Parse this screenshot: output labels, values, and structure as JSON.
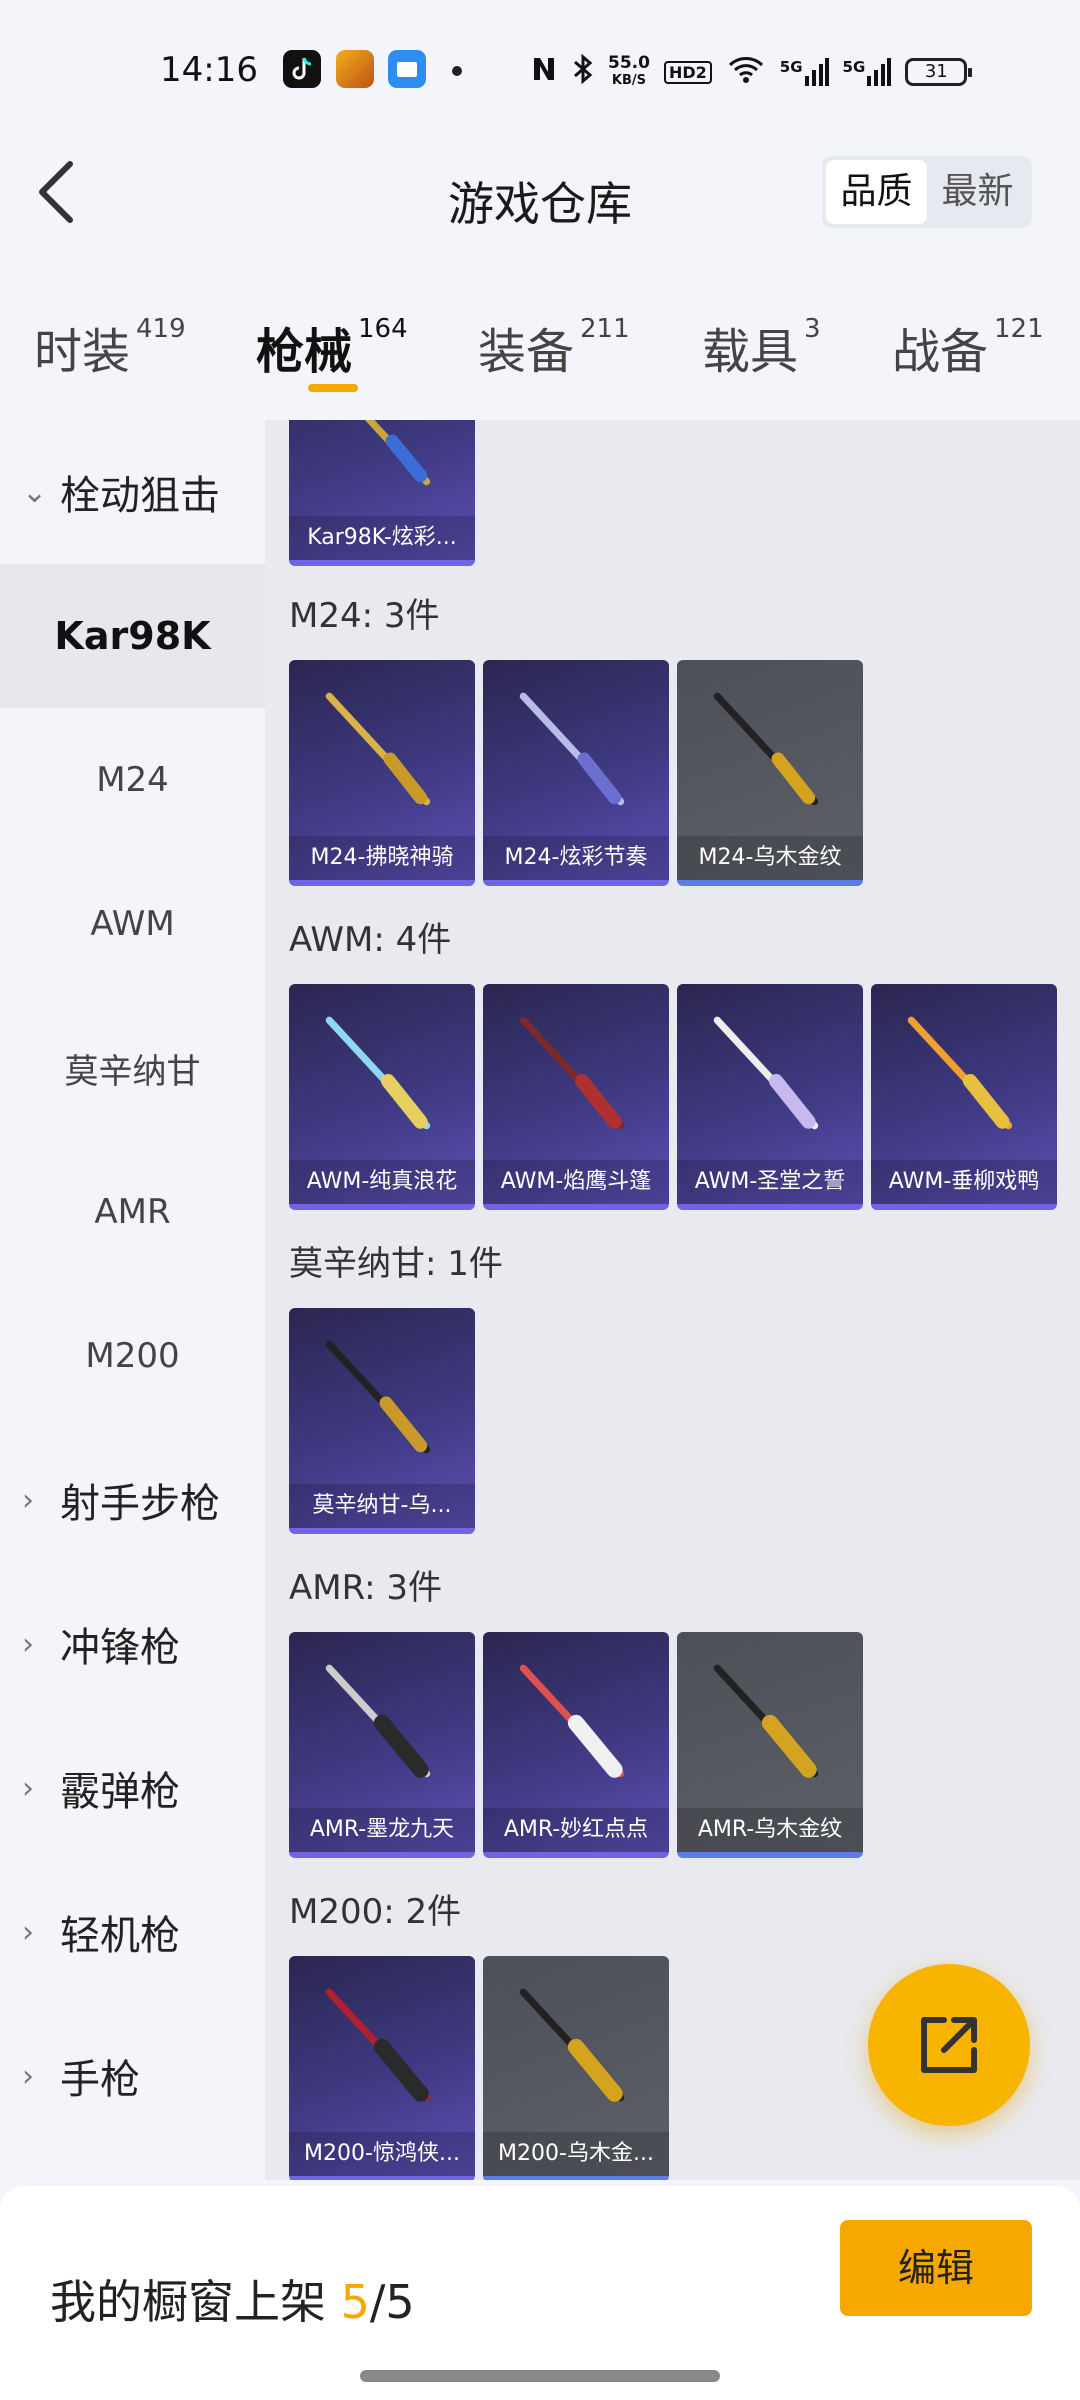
{
  "status_bar": {
    "time": "14:16",
    "net_speed": "55.0",
    "net_unit": "KB/S",
    "hd": "HD2",
    "sig1": "5G",
    "sig2": "5G",
    "battery": "31",
    "icons": [
      "tiktok-icon",
      "game-app-icon",
      "files-app-icon",
      "nfc-icon",
      "bluetooth-icon",
      "wifi-icon"
    ]
  },
  "header": {
    "title": "游戏仓库",
    "sort_options": [
      "品质",
      "最新"
    ],
    "sort_active": "品质"
  },
  "tabs": [
    {
      "label": "时装",
      "count": "419"
    },
    {
      "label": "枪械",
      "count": "164"
    },
    {
      "label": "装备",
      "count": "211"
    },
    {
      "label": "载具",
      "count": "3"
    },
    {
      "label": "战备",
      "count": "121"
    }
  ],
  "active_tab": "枪械",
  "sidebar": {
    "expanded_group": "栓动狙击",
    "sub_items": [
      "Kar98K",
      "M24",
      "AWM",
      "莫辛纳甘",
      "AMR",
      "M200"
    ],
    "selected_sub": "Kar98K",
    "groups": [
      "射手步枪",
      "冲锋枪",
      "霰弹枪",
      "轻机枪",
      "手枪"
    ]
  },
  "sections": [
    {
      "title": "",
      "items": [
        {
          "name": "Kar98K-炫彩...",
          "color": "#3f3a82"
        }
      ]
    },
    {
      "title": "M24: 3件",
      "items": [
        {
          "name": "M24-拂晓神骑"
        },
        {
          "name": "M24-炫彩节奏"
        },
        {
          "name": "M24-乌木金纹"
        }
      ]
    },
    {
      "title": "AWM: 4件",
      "items": [
        {
          "name": "AWM-纯真浪花"
        },
        {
          "name": "AWM-焰鹰斗篷"
        },
        {
          "name": "AWM-圣堂之誓"
        },
        {
          "name": "AWM-垂柳戏鸭"
        }
      ]
    },
    {
      "title": "莫辛纳甘: 1件",
      "items": [
        {
          "name": "莫辛纳甘-乌..."
        }
      ]
    },
    {
      "title": "AMR: 3件",
      "items": [
        {
          "name": "AMR-墨龙九天"
        },
        {
          "name": "AMR-妙红点点"
        },
        {
          "name": "AMR-乌木金纹"
        }
      ]
    },
    {
      "title": "M200: 2件",
      "items": [
        {
          "name": "M200-惊鸿侠..."
        },
        {
          "name": "M200-乌木金..."
        }
      ]
    }
  ],
  "bottom": {
    "showcase_label": "我的橱窗上架",
    "showcase_current": "5",
    "showcase_sep": "/",
    "showcase_total": "5",
    "edit_label": "编辑"
  },
  "colors": {
    "accent": "#f5a800",
    "card_purple": "#3f3a82",
    "card_gray": "#5e6069",
    "card_bar_purple": "#6f64e8",
    "card_bar_blue": "#5b7be8"
  }
}
